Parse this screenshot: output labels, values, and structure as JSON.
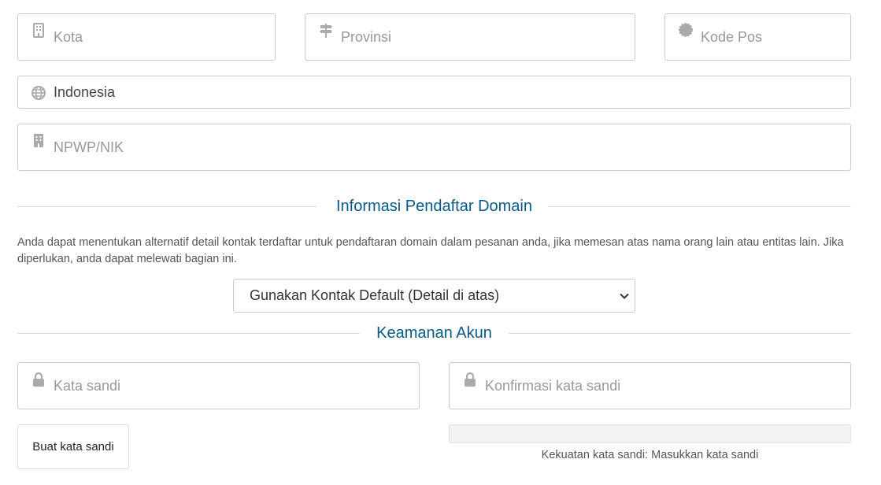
{
  "address": {
    "city": {
      "value": "",
      "placeholder": "Kota",
      "icon": "building-icon"
    },
    "province": {
      "value": "",
      "placeholder": "Provinsi",
      "icon": "signpost-icon"
    },
    "postcode": {
      "value": "",
      "placeholder": "Kode Pos",
      "icon": "certificate-icon"
    },
    "country": {
      "selected": "Indonesia",
      "icon": "globe-icon"
    },
    "tax_id": {
      "value": "",
      "placeholder": "NPWP/NIK",
      "icon": "building-icon"
    }
  },
  "domain_registrant": {
    "title": "Informasi Pendaftar Domain",
    "description": "Anda dapat menentukan alternatif detail kontak terdaftar untuk pendaftaran domain dalam pesanan anda, jika memesan atas nama orang lain atau entitas lain. Jika diperlukan, anda dapat melewati bagian ini.",
    "contact_select": {
      "selected": "Gunakan Kontak Default (Detail di atas)"
    }
  },
  "account_security": {
    "title": "Keamanan Akun",
    "password": {
      "value": "",
      "placeholder": "Kata sandi",
      "icon": "lock-icon"
    },
    "confirm_password": {
      "value": "",
      "placeholder": "Konfirmasi kata sandi",
      "icon": "lock-icon"
    },
    "generate_button": "Buat kata sandi",
    "strength": {
      "level": 0,
      "text": "Kekuatan kata sandi: Masukkan kata sandi"
    }
  },
  "colors": {
    "heading": "#085a89",
    "border": "#cccccc",
    "placeholder": "#999999",
    "icon": "#aaaaaa"
  }
}
